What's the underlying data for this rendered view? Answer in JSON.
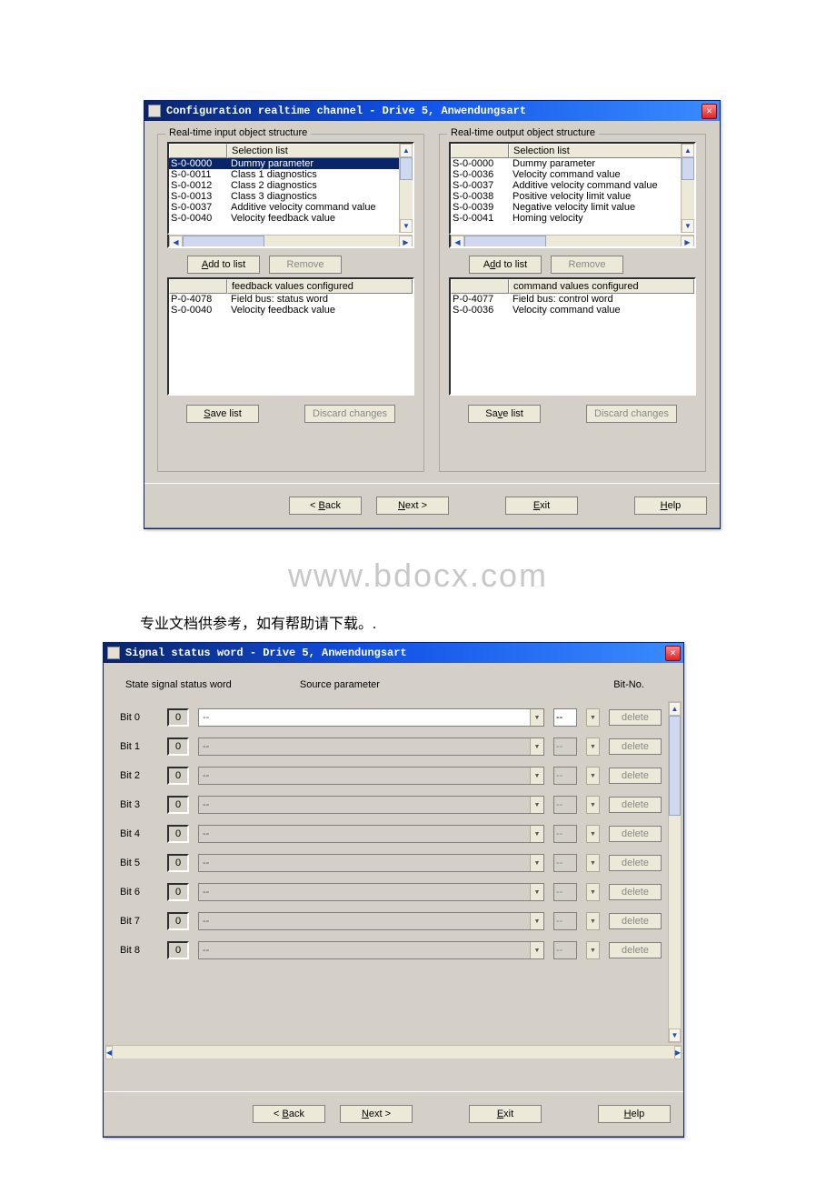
{
  "watermark": "www.bdocx.com",
  "caption_cn": "专业文档供参考，如有帮助请下载。.",
  "window1": {
    "title": "Configuration realtime channel - Drive 5,  Anwendungsart",
    "left": {
      "legend": "Real-time input object structure",
      "selection_header": "Selection list",
      "selection": [
        {
          "code": "S-0-0000",
          "desc": "Dummy parameter",
          "selected": true
        },
        {
          "code": "S-0-0011",
          "desc": "Class 1 diagnostics"
        },
        {
          "code": "S-0-0012",
          "desc": "Class 2 diagnostics"
        },
        {
          "code": "S-0-0013",
          "desc": "Class 3 diagnostics"
        },
        {
          "code": "S-0-0037",
          "desc": "Additive velocity command value"
        },
        {
          "code": "S-0-0040",
          "desc": "Velocity feedback value"
        }
      ],
      "add_btn": "Add to list",
      "remove_btn": "Remove",
      "config_header": "feedback values configured",
      "configured": [
        {
          "code": "P-0-4078",
          "desc": "Field bus: status word"
        },
        {
          "code": "S-0-0040",
          "desc": "Velocity feedback value"
        }
      ],
      "save_btn": "Save list",
      "discard_btn": "Discard changes"
    },
    "right": {
      "legend": "Real-time output object structure",
      "selection_header": "Selection list",
      "selection": [
        {
          "code": "S-0-0000",
          "desc": "Dummy parameter"
        },
        {
          "code": "S-0-0036",
          "desc": "Velocity command value"
        },
        {
          "code": "S-0-0037",
          "desc": "Additive velocity command value"
        },
        {
          "code": "S-0-0038",
          "desc": "Positive velocity limit value"
        },
        {
          "code": "S-0-0039",
          "desc": "Negative velocity limit value"
        },
        {
          "code": "S-0-0041",
          "desc": "Homing velocity"
        }
      ],
      "add_btn": "Add to list",
      "remove_btn": "Remove",
      "config_header": "command values configured",
      "configured": [
        {
          "code": "P-0-4077",
          "desc": "Field bus: control word"
        },
        {
          "code": "S-0-0036",
          "desc": "Velocity command value"
        }
      ],
      "save_btn": "Save list",
      "discard_btn": "Discard changes"
    },
    "nav": {
      "back": "< Back",
      "next": "Next >",
      "exit": "Exit",
      "help": "Help"
    }
  },
  "window2": {
    "title": "Signal status word - Drive 5,  Anwendungsart",
    "headers": {
      "state": "State signal status word",
      "source": "Source parameter",
      "bitno": "Bit-No."
    },
    "rows": [
      {
        "label": "Bit 0",
        "val": "0",
        "src": "--",
        "bit": "--",
        "enabled": true
      },
      {
        "label": "Bit 1",
        "val": "0",
        "src": "--",
        "bit": "--",
        "enabled": false
      },
      {
        "label": "Bit 2",
        "val": "0",
        "src": "--",
        "bit": "--",
        "enabled": false
      },
      {
        "label": "Bit 3",
        "val": "0",
        "src": "--",
        "bit": "--",
        "enabled": false
      },
      {
        "label": "Bit 4",
        "val": "0",
        "src": "--",
        "bit": "--",
        "enabled": false
      },
      {
        "label": "Bit 5",
        "val": "0",
        "src": "--",
        "bit": "--",
        "enabled": false
      },
      {
        "label": "Bit 6",
        "val": "0",
        "src": "--",
        "bit": "--",
        "enabled": false
      },
      {
        "label": "Bit 7",
        "val": "0",
        "src": "--",
        "bit": "--",
        "enabled": false
      },
      {
        "label": "Bit 8",
        "val": "0",
        "src": "--",
        "bit": "--",
        "enabled": false
      }
    ],
    "delete_btn": "delete",
    "nav": {
      "back": "< Back",
      "next": "Next >",
      "exit": "Exit",
      "help": "Help"
    }
  }
}
